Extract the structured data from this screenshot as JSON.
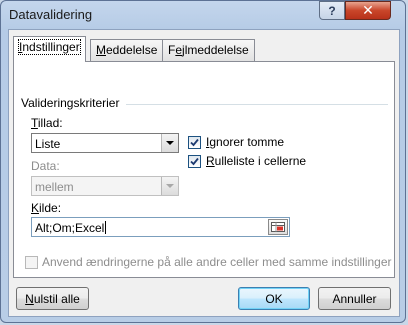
{
  "window": {
    "title": "Datavalidering",
    "help": "?",
    "close": "✕"
  },
  "tabs": [
    {
      "label_u": "I",
      "label_rest": "ndstillinger"
    },
    {
      "label_u": "M",
      "label_rest": "eddelelse"
    },
    {
      "label_pre": "F",
      "label_u": "e",
      "label_rest": "jlmeddelelse"
    }
  ],
  "criteria": {
    "group_label": "Valideringskriterier",
    "allow_label_u": "T",
    "allow_label_rest": "illad:",
    "allow_value": "Liste",
    "data_label": "Data:",
    "data_value": "mellem",
    "ignore_blank": {
      "u": "I",
      "rest": "gnorer tomme",
      "pre": "",
      "checked": true
    },
    "in_cell_dropdown": {
      "u": "R",
      "rest": "ulleliste i cellerne",
      "checked": true
    },
    "source_label_u": "K",
    "source_label_rest": "ilde:",
    "source_value": "Alt;Om;Excel"
  },
  "apply_all": {
    "label": "Anvend ændringerne på alle andre celler med samme indstillinger",
    "checked": false
  },
  "buttons": {
    "clear_u": "N",
    "clear_rest": "ulstil alle",
    "ok": "OK",
    "cancel": "Annuller"
  }
}
